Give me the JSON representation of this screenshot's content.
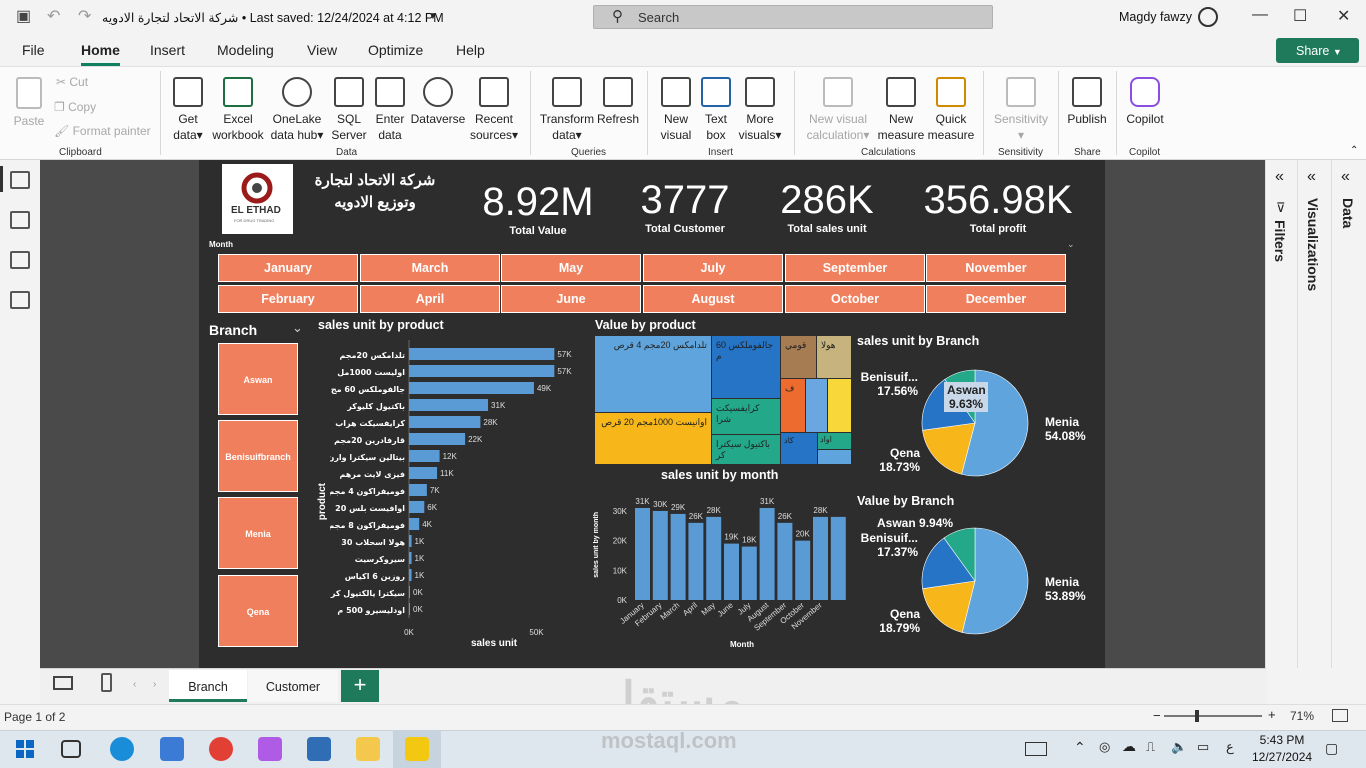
{
  "titlebar": {
    "doc_title": "شركة الاتحاد لتجارة الادويه • Last saved: 12/24/2024 at 4:12 PM",
    "search_placeholder": "Search",
    "user": "Magdy fawzy"
  },
  "menu": {
    "items": [
      "File",
      "Home",
      "Insert",
      "Modeling",
      "View",
      "Optimize",
      "Help"
    ],
    "share_label": "Share"
  },
  "ribbon": {
    "clipboard": {
      "paste": "Paste",
      "cut": "Cut",
      "copy": "Copy",
      "format_painter": "Format painter",
      "group": "Clipboard"
    },
    "data": {
      "get_data": [
        "Get",
        "data"
      ],
      "excel": [
        "Excel",
        "workbook"
      ],
      "onelake": [
        "OneLake",
        "data hub"
      ],
      "sql": [
        "SQL",
        "Server"
      ],
      "enter": [
        "Enter",
        "data"
      ],
      "dataverse": "Dataverse",
      "recent": [
        "Recent",
        "sources"
      ],
      "group": "Data"
    },
    "queries": {
      "transform": [
        "Transform",
        "data"
      ],
      "refresh": "Refresh",
      "group": "Queries"
    },
    "insert": {
      "new_visual": [
        "New",
        "visual"
      ],
      "text_box": [
        "Text",
        "box"
      ],
      "more_visuals": [
        "More",
        "visuals"
      ],
      "group": "Insert"
    },
    "calculations": {
      "new_visual_calc": [
        "New visual",
        "calculation"
      ],
      "new_measure": [
        "New",
        "measure"
      ],
      "quick_measure": [
        "Quick",
        "measure"
      ],
      "group": "Calculations"
    },
    "sensitivity": {
      "label": "Sensitivity",
      "group": "Sensitivity"
    },
    "share": {
      "publish": "Publish",
      "group": "Share"
    },
    "copilot": {
      "label": "Copilot",
      "group": "Copilot"
    }
  },
  "report": {
    "logo_text": "EL ETHAD",
    "logo_sub": "FOR DRUG TRADING",
    "company_line1": "شركة الاتحاد لتجارة",
    "company_line2": "وتوزيع الادويه",
    "kpis": [
      {
        "value": "8.92M",
        "label": "Total Value"
      },
      {
        "value": "3777",
        "label": "Total Customer"
      },
      {
        "value": "286K",
        "label": "Total sales unit"
      },
      {
        "value": "356.98K",
        "label": "Total profit"
      }
    ],
    "month_slicer_label": "Month",
    "months_row1": [
      "January",
      "March",
      "May",
      "July",
      "September",
      "November"
    ],
    "months_row2": [
      "February",
      "April",
      "June",
      "August",
      "October",
      "December"
    ],
    "branch_title": "Branch",
    "branches": [
      "Aswan",
      "Benisuifbranch",
      "Menia",
      "Qena"
    ],
    "accent": "#f07f5d",
    "bar_color": "#5b9bd5"
  },
  "chart_data": [
    {
      "type": "bar",
      "orientation": "horizontal",
      "title": "sales unit by product",
      "xlabel": "sales unit",
      "ylabel": "product",
      "categories": [
        "تلدامكس 20مجم",
        "اوليست 1000مل",
        "جالفوملكس 60 مج",
        "باكتيول كليوكر",
        "كرايفسيكت هراب",
        "قارفادرين 20مجم",
        "بيتالين سيكترا وارن",
        "فيزى لايت مرهم",
        "فوميفراكون 4 مجم",
        "اوافيست بلس 20",
        "فوميفراكون 8 مجم",
        "هولا اسحلاب 30",
        "سيروكرسيت",
        "روزين 6 اكياس",
        "سيكترا يالكتيول كر",
        "اودليسيرو 500 م"
      ],
      "values": [
        57000,
        57000,
        49000,
        31000,
        28000,
        22000,
        12000,
        11000,
        7000,
        6000,
        4000,
        1000,
        1000,
        1000,
        0,
        0
      ],
      "value_labels": [
        "57K",
        "57K",
        "49K",
        "31K",
        "28K",
        "22K",
        "12K",
        "11K",
        "7K",
        "6K",
        "4K",
        "1K",
        "1K",
        "1K",
        "0K",
        "0K"
      ],
      "xticks": [
        "0K",
        "50K"
      ],
      "xlim": [
        0,
        60000
      ]
    },
    {
      "type": "treemap",
      "title": "Value by product",
      "labels": [
        "تلدامكس 20مجم 4 قرص",
        "اوانيست 1000مجم 20 قرص",
        "جالفوملكس 60 م",
        "كرايفسيكت شرا",
        "باكتيول سيكترا كر",
        "قومي",
        "هولا",
        "ف",
        "كاد",
        "اواد"
      ]
    },
    {
      "type": "bar",
      "title": "sales unit by month",
      "xlabel": "Month",
      "ylabel": "sales unit by month",
      "categories": [
        "January",
        "February",
        "March",
        "April",
        "May",
        "June",
        "July",
        "August",
        "September",
        "October",
        "November",
        "December"
      ],
      "values": [
        31000,
        30000,
        29000,
        26000,
        28000,
        19000,
        18000,
        31000,
        26000,
        20000,
        28000,
        28000
      ],
      "value_labels": [
        "31K",
        "30K",
        "29K",
        "26K",
        "28K",
        "19K",
        "18K",
        "31K",
        "26K",
        "20K",
        "28K",
        ""
      ],
      "xtick_labels": [
        "January",
        "February",
        "March",
        "April",
        "May",
        "June",
        "July",
        "August",
        "September",
        "October",
        "November",
        ""
      ],
      "yticks": [
        "0K",
        "10K",
        "20K",
        "30K"
      ],
      "ylim": [
        0,
        35000
      ]
    },
    {
      "type": "pie",
      "title": "sales unit by Branch",
      "labels": [
        "Menia",
        "Qena",
        "Benisuif...",
        "Aswan"
      ],
      "values": [
        54.08,
        18.73,
        17.56,
        9.63
      ],
      "value_labels": [
        "54.08%",
        "18.73%",
        "17.56%",
        "9.63%"
      ],
      "colors": [
        "#5fa4dc",
        "#f7b619",
        "#2674c6",
        "#23a88a"
      ]
    },
    {
      "type": "pie",
      "title": "Value by Branch",
      "labels": [
        "Menia",
        "Qena",
        "Benisuif...",
        "Aswan"
      ],
      "values": [
        53.89,
        18.79,
        17.37,
        9.94
      ],
      "value_labels": [
        "53.89%",
        "18.79%",
        "17.37%",
        "9.94%"
      ],
      "colors": [
        "#5fa4dc",
        "#f7b619",
        "#2674c6",
        "#23a88a"
      ]
    }
  ],
  "panes": {
    "filters": "Filters",
    "visualizations": "Visualizations",
    "data": "Data"
  },
  "tabs": [
    "Branch",
    "Customer"
  ],
  "status": {
    "page": "Page 1 of 2",
    "zoom": "71%"
  },
  "taskbar": {
    "time": "5:43 PM",
    "date": "12/27/2024"
  },
  "watermark": {
    "arabic": "مستقل",
    "latin": "mostaql.com"
  }
}
